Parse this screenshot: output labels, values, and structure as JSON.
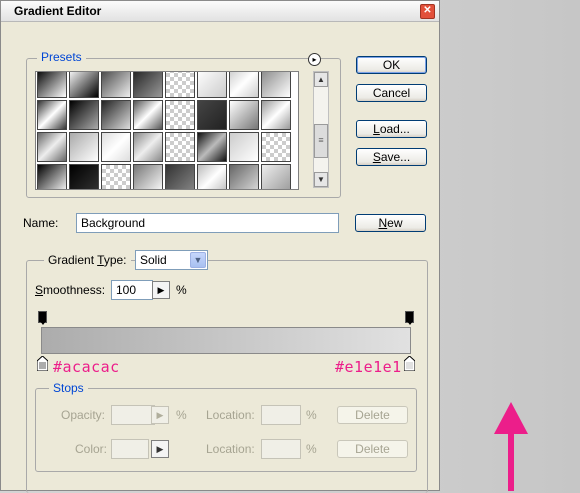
{
  "window": {
    "title": "Gradient Editor",
    "close_glyph": "✕"
  },
  "presets": {
    "legend": "Presets",
    "menu_glyph": "▸",
    "swatches": [
      "linear-gradient(135deg,#000,#fff)",
      "linear-gradient(135deg,#fff,#000)",
      "linear-gradient(135deg,#444,#eee)",
      "linear-gradient(135deg,#222,#999)",
      "checker",
      "linear-gradient(135deg,#fff,#ccc)",
      "linear-gradient(135deg,#ccc,#fff,#ccc)",
      "linear-gradient(135deg,#888,#fff)",
      "linear-gradient(135deg,#333,#fff,#333)",
      "linear-gradient(135deg,#000,#aaa)",
      "linear-gradient(135deg,#222,#ddd)",
      "linear-gradient(135deg,#555,#fff,#555)",
      "checker",
      "linear-gradient(135deg,#444,#222)",
      "linear-gradient(135deg,#fff,#777)",
      "linear-gradient(135deg,#999,#fff,#999)",
      "linear-gradient(135deg,#666,#eee,#666)",
      "linear-gradient(135deg,#aaa,#fff)",
      "linear-gradient(135deg,#ddd,#fff,#ddd)",
      "linear-gradient(135deg,#888,#eee,#888)",
      "checker",
      "linear-gradient(135deg,#111,#bbb,#111)",
      "linear-gradient(135deg,#ccc,#fff)",
      "checker",
      "linear-gradient(135deg,#000,#fff)",
      "linear-gradient(135deg,#000,#333)",
      "checker",
      "linear-gradient(135deg,#777,#fff)",
      "linear-gradient(135deg,#333,#888)",
      "linear-gradient(135deg,#bbb,#fff,#bbb)",
      "linear-gradient(135deg,#666,#ddd)",
      "linear-gradient(135deg,#eee,#999)"
    ],
    "scroll_up": "▲",
    "scroll_down": "▼",
    "thumb_glyph": "≡"
  },
  "buttons": {
    "ok": "OK",
    "cancel": "Cancel",
    "load": "Load...",
    "save": "Save...",
    "new": "New"
  },
  "name": {
    "label": "Name:",
    "value": "Background"
  },
  "gradient": {
    "type_label": "Gradient Type:",
    "type_value": "Solid",
    "smoothness_label": "Smoothness:",
    "smoothness_value": "100",
    "percent": "%",
    "start_color": "#acacac",
    "end_color": "#e1e1e1",
    "hex_left": "#acacac",
    "hex_right": "#e1e1e1"
  },
  "stops": {
    "legend": "Stops",
    "opacity_label": "Opacity:",
    "color_label": "Color:",
    "location_label": "Location:",
    "percent": "%",
    "delete_label": "Delete"
  },
  "accent_color": "#ec1e8a"
}
